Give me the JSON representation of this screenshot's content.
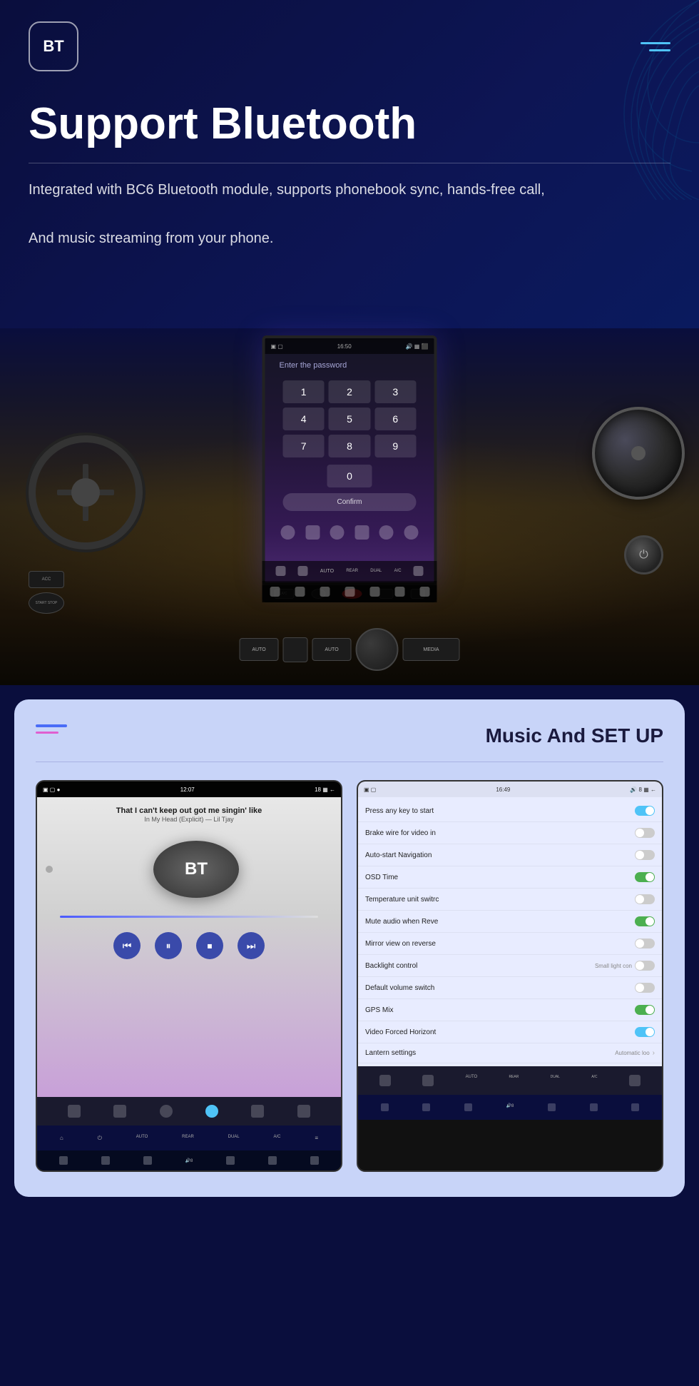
{
  "header": {
    "logo_text": "BT",
    "title": "Support Bluetooth",
    "description_line1": "Integrated with BC6 Bluetooth module, supports phonebook sync, hands-free call,",
    "description_line2": "And music streaming from your phone."
  },
  "music_section": {
    "title": "Music And SET UP",
    "music_player": {
      "track_title": "That I can't keep out got me singin' like",
      "track_subtitle": "In My Head (Explicit) — Lil Tjay",
      "album_art_label": "BT",
      "controls": [
        "⏮",
        "⏭",
        "⏹",
        "⏭"
      ]
    },
    "settings": {
      "items": [
        {
          "label": "Press any key to start",
          "toggle": "on"
        },
        {
          "label": "Brake wire for video in",
          "toggle": "off"
        },
        {
          "label": "Auto-start Navigation",
          "toggle": "off"
        },
        {
          "label": "OSD Time",
          "toggle": "on-green"
        },
        {
          "label": "Temperature unit switrc",
          "toggle": "off"
        },
        {
          "label": "Mute audio when Reve",
          "toggle": "on-green"
        },
        {
          "label": "Mirror view on reverse",
          "toggle": "off"
        },
        {
          "label": "Backlight control",
          "extra": "Small light con",
          "toggle": "off"
        },
        {
          "label": "Default volume switch",
          "toggle": "off"
        },
        {
          "label": "GPS Mix",
          "toggle": "on-green"
        },
        {
          "label": "Video Forced Horizont",
          "toggle": "on"
        },
        {
          "label": "Lantern settings",
          "extra": "Automatic loo",
          "chevron": true
        }
      ]
    }
  },
  "password_screen": {
    "prompt": "Enter the password",
    "numpad": [
      "1",
      "2",
      "3",
      "4",
      "5",
      "6",
      "7",
      "8",
      "9",
      "0"
    ],
    "confirm_label": "Confirm"
  },
  "icons": {
    "hamburger": "☰",
    "bt_logo": "BT",
    "rewind": "⏮",
    "play_pause": "⏸",
    "stop": "⏹",
    "fast_forward": "⏭"
  }
}
